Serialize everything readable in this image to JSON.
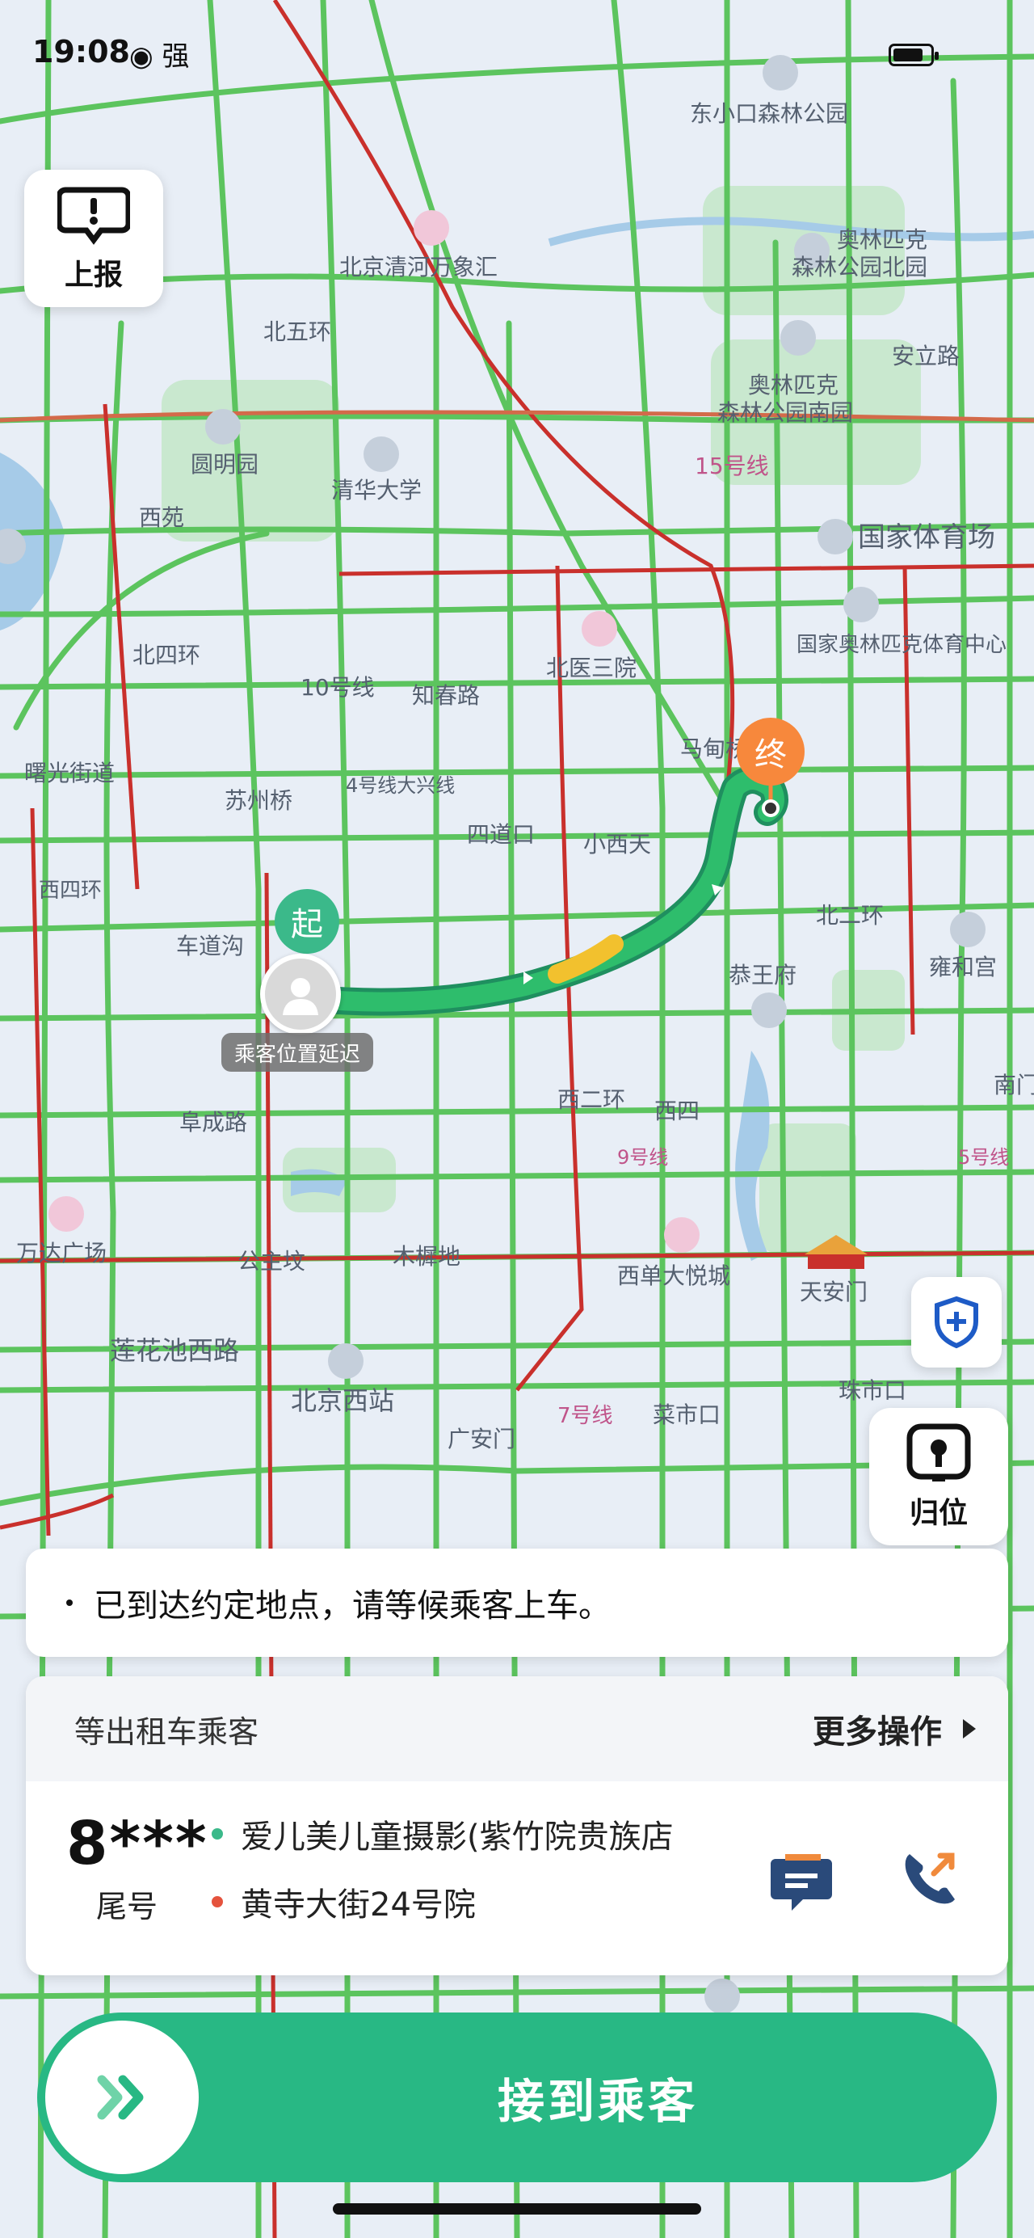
{
  "status_bar": {
    "time": "19:08",
    "signal": "强"
  },
  "map": {
    "labels": [
      {
        "id": "dongxiaokou",
        "text": "东小口森林公园"
      },
      {
        "id": "aolin-north",
        "text": "奥林匹克"
      },
      {
        "id": "aolin-north2",
        "text": "森林公园北园"
      },
      {
        "id": "qinghe",
        "text": "北京清河万象汇"
      },
      {
        "id": "beiwuhuan",
        "text": "北五环"
      },
      {
        "id": "aolin-south",
        "text": "奥林匹克"
      },
      {
        "id": "aolin-south2",
        "text": "森林公园南园"
      },
      {
        "id": "anli",
        "text": "安立路"
      },
      {
        "id": "yuanmingyuan",
        "text": "圆明园"
      },
      {
        "id": "tsinghua",
        "text": "清华大学"
      },
      {
        "id": "line15",
        "text": "15号线"
      },
      {
        "id": "guojiatiyuchang",
        "text": "国家体育场"
      },
      {
        "id": "xiyuan",
        "text": "西苑"
      },
      {
        "id": "beisihuan",
        "text": "北四环"
      },
      {
        "id": "beiyisanyuan",
        "text": "北医三院"
      },
      {
        "id": "aoti",
        "text": "国家奥林匹克体育中心"
      },
      {
        "id": "line10",
        "text": "10号线"
      },
      {
        "id": "zhichunlu",
        "text": "知春路"
      },
      {
        "id": "madian",
        "text": "马甸桥"
      },
      {
        "id": "shuguang",
        "text": "曙光街道"
      },
      {
        "id": "suzhouqiao",
        "text": "苏州桥"
      },
      {
        "id": "line4",
        "text": "4号线大兴线"
      },
      {
        "id": "sidaokou",
        "text": "四道口"
      },
      {
        "id": "xiaoxitian",
        "text": "小西天"
      },
      {
        "id": "xisihuan",
        "text": "西四环"
      },
      {
        "id": "chedaogou",
        "text": "车道沟"
      },
      {
        "id": "beierhuan",
        "text": "北二环"
      },
      {
        "id": "gongwangfu",
        "text": "恭王府"
      },
      {
        "id": "yonghegong",
        "text": "雍和宫"
      },
      {
        "id": "fuchenglu",
        "text": "阜成路"
      },
      {
        "id": "xierhuan",
        "text": "西二环"
      },
      {
        "id": "xisi",
        "text": "西四"
      },
      {
        "id": "line9",
        "text": "9号线"
      },
      {
        "id": "line5",
        "text": "5号线"
      },
      {
        "id": "wanda",
        "text": "万达广场"
      },
      {
        "id": "gongzhufen",
        "text": "公主坟"
      },
      {
        "id": "muxidi",
        "text": "木樨地"
      },
      {
        "id": "xidan",
        "text": "西单大悦城"
      },
      {
        "id": "tiananmen",
        "text": "天安门"
      },
      {
        "id": "lianhuachi",
        "text": "莲花池西路"
      },
      {
        "id": "beijingxi",
        "text": "北京西站"
      },
      {
        "id": "guanganmen",
        "text": "广安门"
      },
      {
        "id": "line7",
        "text": "7号线"
      },
      {
        "id": "caishikou",
        "text": "菜市口"
      },
      {
        "id": "zhushikou",
        "text": "珠市口"
      },
      {
        "id": "nanmen",
        "text": "南门"
      }
    ]
  },
  "buttons": {
    "report": "上报",
    "recenter": "归位"
  },
  "markers": {
    "start": "起",
    "end": "终",
    "passenger_delay": "乘客位置延迟"
  },
  "notice": {
    "text": "已到达约定地点，请等候乘客上车。"
  },
  "order_card": {
    "title": "等出租车乘客",
    "more": "更多操作",
    "tail_number": "8***",
    "tail_label": "尾号",
    "pickup_address": "爱儿美儿童摄影(紫竹院贵族店",
    "dest_address": "黄寺大街24号院",
    "colors": {
      "pickup": "#3bb98a",
      "dest": "#e5533d",
      "icons": "#2a4a7a",
      "call_accent": "#f08a3c"
    }
  },
  "action": {
    "label": "接到乘客",
    "color": "#28b884"
  }
}
